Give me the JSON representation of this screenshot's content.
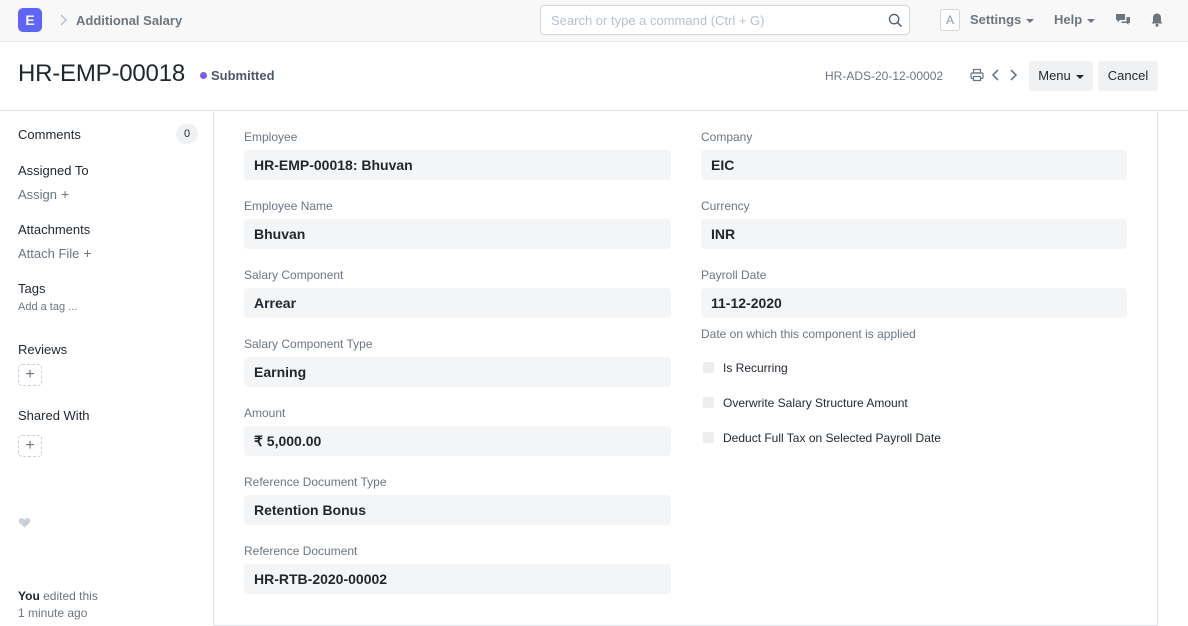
{
  "navbar": {
    "logo_letter": "E",
    "breadcrumb": "Additional Salary",
    "search_placeholder": "Search or type a command (Ctrl + G)",
    "avatar_letter": "A",
    "settings_label": "Settings",
    "help_label": "Help"
  },
  "header": {
    "title": "HR-EMP-00018",
    "status": "Submitted",
    "status_color": "#7b5cf0",
    "doc_name": "HR-ADS-20-12-00002",
    "menu_label": "Menu",
    "cancel_label": "Cancel"
  },
  "sidebar": {
    "comments_label": "Comments",
    "comments_count": "0",
    "assigned_to_label": "Assigned To",
    "assign_label": "Assign",
    "attachments_label": "Attachments",
    "attach_file_label": "Attach File",
    "tags_label": "Tags",
    "add_tag_label": "Add a tag ...",
    "reviews_label": "Reviews",
    "shared_with_label": "Shared With",
    "edit_user": "You",
    "edit_action": "edited this",
    "edit_time": "1 minute ago"
  },
  "form": {
    "left": [
      {
        "label": "Employee",
        "value": "HR-EMP-00018: Bhuvan"
      },
      {
        "label": "Employee Name",
        "value": "Bhuvan"
      },
      {
        "label": "Salary Component",
        "value": "Arrear"
      },
      {
        "label": "Salary Component Type",
        "value": "Earning"
      },
      {
        "label": "Amount",
        "value": "₹ 5,000.00"
      },
      {
        "label": "Reference Document Type",
        "value": "Retention Bonus"
      },
      {
        "label": "Reference Document",
        "value": "HR-RTB-2020-00002"
      }
    ],
    "right": [
      {
        "label": "Company",
        "value": "EIC"
      },
      {
        "label": "Currency",
        "value": "INR"
      },
      {
        "label": "Payroll Date",
        "value": "11-12-2020"
      }
    ],
    "payroll_date_help": "Date on which this component is applied",
    "checkboxes": [
      {
        "label": "Is Recurring",
        "checked": false
      },
      {
        "label": "Overwrite Salary Structure Amount",
        "checked": false
      },
      {
        "label": "Deduct Full Tax on Selected Payroll Date",
        "checked": false
      }
    ]
  }
}
